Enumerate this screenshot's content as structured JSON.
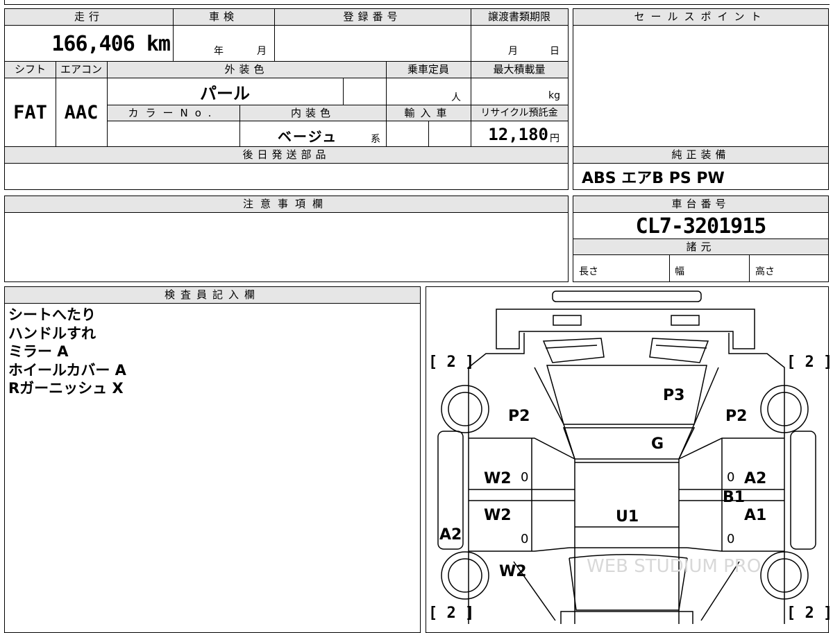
{
  "header": {
    "mileage_label": "走行",
    "mileage_value": "166,406 km",
    "inspection_label": "車検",
    "inspection_year_unit": "年",
    "inspection_month_unit": "月",
    "registration_label": "登録番号",
    "transfer_deadline_label": "譲渡書類期限",
    "transfer_month_unit": "月",
    "transfer_day_unit": "日",
    "shift_label": "シフト",
    "shift_value": "FAT",
    "ac_label": "エアコン",
    "ac_value": "AAC",
    "exterior_color_label": "外装色",
    "exterior_color_value": "パール",
    "color_no_label": "カラーNo.",
    "interior_color_label": "内装色",
    "interior_color_value": "ベージュ",
    "interior_color_suffix": "系",
    "capacity_label": "乗車定員",
    "capacity_unit": "人",
    "max_load_label": "最大積載量",
    "max_load_unit": "kg",
    "import_label": "輸入車",
    "recycle_label": "リサイクル預託金",
    "recycle_value": "12,180",
    "recycle_unit": "円",
    "later_parts_label": "後日発送部品"
  },
  "sales_point": {
    "label": "セールスポイント"
  },
  "equipment": {
    "label": "純正装備",
    "value": "ABS エアB PS PW"
  },
  "remarks": {
    "label": "注意事項欄"
  },
  "chassis": {
    "label": "車台番号",
    "value": "CL7-3201915",
    "spec_label": "諸元",
    "length_label": "長さ",
    "width_label": "幅",
    "height_label": "高さ"
  },
  "inspector": {
    "label": "検査員記入欄",
    "notes": [
      "シートへたり",
      "ハンドルすれ",
      "ミラー A",
      "ホイールカバー A",
      "Rガーニッシュ X"
    ]
  },
  "damage_map": {
    "tire_fl": "[ 2 ]",
    "tire_fr": "[ 2 ]",
    "tire_rl": "[ 2 ]",
    "tire_rr": "[ 2 ]",
    "roof": "P3",
    "glass": "G",
    "left_fender": "P2",
    "right_fender": "P2",
    "left_front_door": "W2",
    "left_rear_door": "W2",
    "left_rear_fender": "W2",
    "left_side": "A2",
    "right_front_door": "A2",
    "right_pillar": "B1",
    "right_rear_door": "A1",
    "interior": "U1",
    "mark_zero": "0",
    "watermark": "WEB STUDIUM PRO"
  }
}
